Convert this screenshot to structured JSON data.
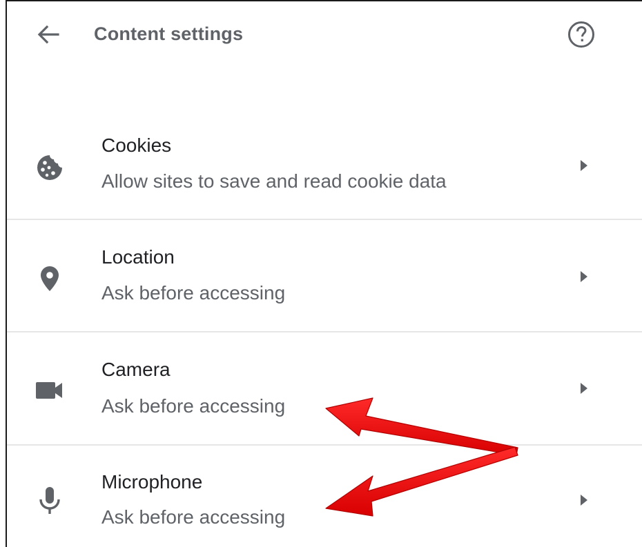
{
  "header": {
    "title": "Content settings",
    "back_icon": "arrow-back-icon",
    "help_icon": "help-circle-icon"
  },
  "settings": [
    {
      "title": "Cookies",
      "subtitle": "Allow sites to save and read cookie data",
      "icon": "cookie-icon"
    },
    {
      "title": "Location",
      "subtitle": "Ask before accessing",
      "icon": "location-pin-icon"
    },
    {
      "title": "Camera",
      "subtitle": "Ask before accessing",
      "icon": "videocam-icon"
    },
    {
      "title": "Microphone",
      "subtitle": "Ask before accessing",
      "icon": "microphone-icon"
    }
  ],
  "colors": {
    "title_text": "#202124",
    "secondary_text": "#5f6368",
    "divider": "#e6e6e6",
    "annotation_arrow": "#ee1111"
  }
}
